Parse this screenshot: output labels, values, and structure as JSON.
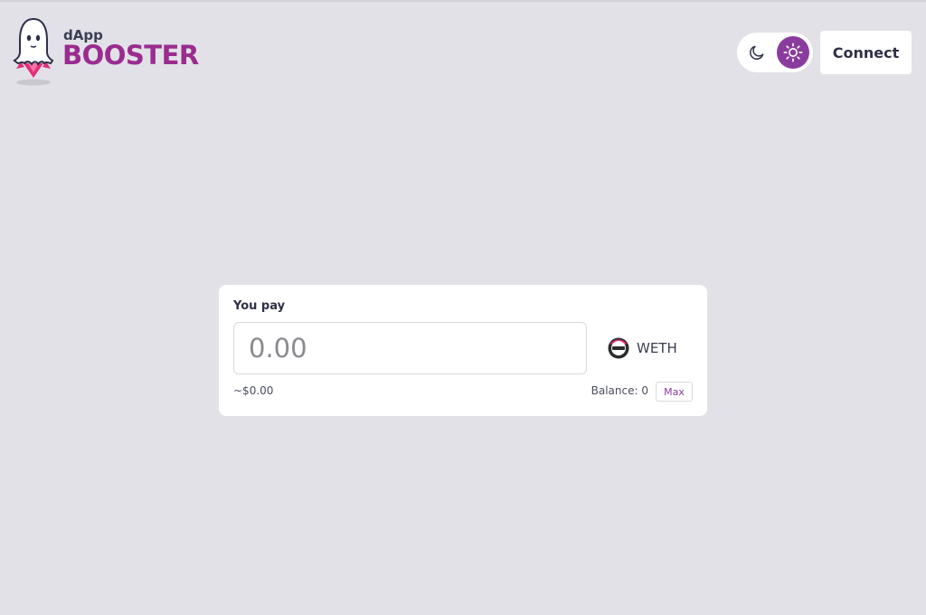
{
  "header": {
    "logo": {
      "line1": "dApp",
      "line2": "BOOSTER"
    },
    "theme_toggle": {
      "dark_icon": "moon-icon",
      "light_icon": "sun-icon",
      "active": "light"
    },
    "connect_label": "Connect"
  },
  "swap_card": {
    "label": "You pay",
    "amount_placeholder": "0.00",
    "amount_value": "",
    "token": {
      "symbol": "WETH",
      "icon": "weth-token-icon"
    },
    "usd_value": "~$0.00",
    "balance": "Balance: 0",
    "max_label": "Max"
  },
  "colors": {
    "background": "#e2e1e7",
    "accent": "#8a3c9e",
    "brand": "#9a2c8f",
    "card": "#ffffff"
  }
}
